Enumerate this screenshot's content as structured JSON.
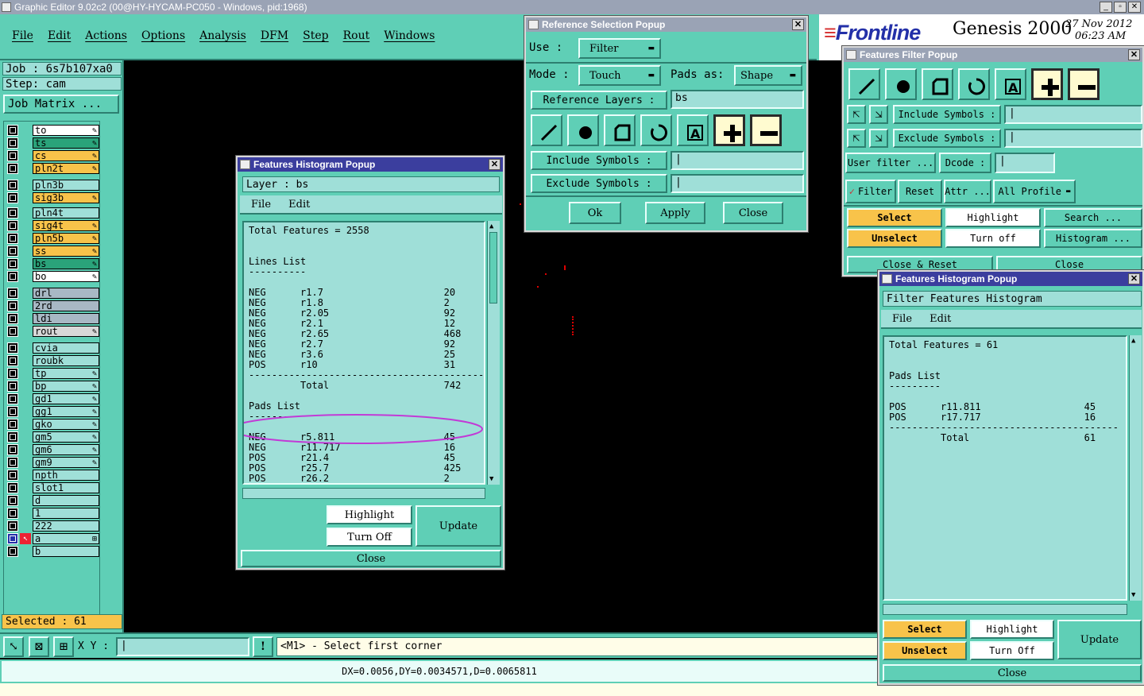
{
  "window_title": "Graphic Editor 9.02c2 (00@HY-HYCAM-PC050 - Windows, pid:1968)",
  "colors": {
    "teal": "#5fcfb6",
    "light": "#9fdfd8",
    "title_active": "#3b3e9e",
    "title_inactive": "#9aa3b5",
    "yellow": "#f8c34a",
    "highlight_ellipse": "#c23ad6"
  },
  "menu": [
    "File",
    "Edit",
    "Actions",
    "Options",
    "Analysis",
    "DFM",
    "Step",
    "Rout",
    "Windows"
  ],
  "brand": {
    "logo": "Frontline",
    "product": "Genesis 2000",
    "date": "27 Nov 2012",
    "time": "06:23 AM"
  },
  "job": {
    "job_label": "Job : 6s7b107xa0",
    "step_label": "Step: cam",
    "matrix_button": "Job Matrix ..."
  },
  "layers": [
    {
      "name": "to",
      "color": "#ffffff",
      "flag": true
    },
    {
      "name": "ts",
      "color": "#2aa37a",
      "flag": true
    },
    {
      "name": "cs",
      "color": "#f8c34a",
      "flag": true
    },
    {
      "name": "pln2t",
      "color": "#f8c34a",
      "flag": true
    },
    {
      "name": "pln3b",
      "color": "#9fdfd8",
      "flag": false
    },
    {
      "name": "sig3b",
      "color": "#f8c34a",
      "flag": true
    },
    {
      "name": "pln4t",
      "color": "#9fdfd8",
      "flag": false
    },
    {
      "name": "sig4t",
      "color": "#f8c34a",
      "flag": true
    },
    {
      "name": "pln5b",
      "color": "#f8c34a",
      "flag": true
    },
    {
      "name": "ss",
      "color": "#f8c34a",
      "flag": true
    },
    {
      "name": "bs",
      "color": "#2aa37a",
      "flag": true
    },
    {
      "name": "bo",
      "color": "#ffffff",
      "flag": true
    },
    {
      "name": "drl",
      "color": "#a8b8c4",
      "flag": false
    },
    {
      "name": "2rd",
      "color": "#a8b8c4",
      "flag": false
    },
    {
      "name": "ldi",
      "color": "#a8b8c4",
      "flag": false
    },
    {
      "name": "rout",
      "color": "#d8d8d8",
      "flag": true
    },
    {
      "name": "cvia",
      "color": "#9fdfd8",
      "flag": false
    },
    {
      "name": "roubk",
      "color": "#9fdfd8",
      "flag": false
    },
    {
      "name": "tp",
      "color": "#9fdfd8",
      "flag": true
    },
    {
      "name": "bp",
      "color": "#9fdfd8",
      "flag": true
    },
    {
      "name": "gd1",
      "color": "#9fdfd8",
      "flag": true
    },
    {
      "name": "gg1",
      "color": "#9fdfd8",
      "flag": true
    },
    {
      "name": "gko",
      "color": "#9fdfd8",
      "flag": true
    },
    {
      "name": "gm5",
      "color": "#9fdfd8",
      "flag": true
    },
    {
      "name": "gm6",
      "color": "#9fdfd8",
      "flag": true
    },
    {
      "name": "gm9",
      "color": "#9fdfd8",
      "flag": true
    },
    {
      "name": "npth",
      "color": "#9fdfd8",
      "flag": false
    },
    {
      "name": "slot1",
      "color": "#9fdfd8",
      "flag": false
    },
    {
      "name": "d",
      "color": "#9fdfd8",
      "flag": false
    },
    {
      "name": "1",
      "color": "#9fdfd8",
      "flag": false
    },
    {
      "name": "222",
      "color": "#9fdfd8",
      "flag": false
    },
    {
      "name": "a",
      "color": "#9fdfd8",
      "flag": true
    },
    {
      "name": "b",
      "color": "#9fdfd8",
      "flag": false
    }
  ],
  "selected_label": "Selected : 61",
  "bottom": {
    "xy_label": "X Y :",
    "prompt": "<M1> - Select first corner",
    "status": "DX=0.0056,DY=0.0034571,D=0.0065811"
  },
  "ref_popup": {
    "title": "Reference Selection Popup",
    "use_label": "Use  :",
    "use_value": "Filter",
    "mode_label": "Mode  :",
    "mode_value": "Touch",
    "pads_label": "Pads as:",
    "pads_value": "Shape",
    "ref_layers_label": "Reference Layers :",
    "ref_layers_value": "bs",
    "include_label": "Include Symbols :",
    "exclude_label": "Exclude Symbols :",
    "ok": "Ok",
    "apply": "Apply",
    "close": "Close"
  },
  "filter_popup": {
    "title": "Features Filter Popup",
    "include_label": "Include Symbols :",
    "exclude_label": "Exclude Symbols :",
    "user_filter": "User filter ...",
    "dcode": "Dcode :",
    "filter": "Filter",
    "reset": "Reset",
    "attr": "Attr ...",
    "profile": "All Profile",
    "select": "Select",
    "highlight": "Highlight",
    "search": "Search ...",
    "unselect": "Unselect",
    "turn_off": "Turn off",
    "histogram": "Histogram ...",
    "close_reset": "Close & Reset",
    "close": "Close"
  },
  "hist1": {
    "title": "Features Histogram Popup",
    "layer_label": "Layer :  bs",
    "menu_file": "File",
    "menu_edit": "Edit",
    "total": "Total Features = 2558",
    "lines_title": "Lines List",
    "lines": [
      [
        "NEG",
        "r1.7",
        "20"
      ],
      [
        "NEG",
        "r1.8",
        "2"
      ],
      [
        "NEG",
        "r2.05",
        "92"
      ],
      [
        "NEG",
        "r2.1",
        "12"
      ],
      [
        "NEG",
        "r2.65",
        "468"
      ],
      [
        "NEG",
        "r2.7",
        "92"
      ],
      [
        "NEG",
        "r3.6",
        "25"
      ],
      [
        "POS",
        "r10",
        "31"
      ]
    ],
    "lines_total_label": "Total",
    "lines_total": "742",
    "pads_title": "Pads List",
    "pads": [
      [
        "NEG",
        "r5.811",
        "45"
      ],
      [
        "NEG",
        "r11.717",
        "16"
      ],
      [
        "POS",
        "r21.4",
        "45"
      ],
      [
        "POS",
        "r25.7",
        "425"
      ],
      [
        "POS",
        "r26.2",
        "2"
      ]
    ],
    "highlight": "Highlight",
    "turn_off": "Turn Off",
    "update": "Update",
    "close": "Close"
  },
  "hist2": {
    "title": "Features Histogram Popup",
    "header": "Filter Features Histogram",
    "menu_file": "File",
    "menu_edit": "Edit",
    "total": "Total Features = 61",
    "pads_title": "Pads List",
    "pads": [
      [
        "POS",
        "r11.811",
        "45"
      ],
      [
        "POS",
        "r17.717",
        "16"
      ]
    ],
    "total_label": "Total",
    "total_value": "61",
    "select": "Select",
    "highlight": "Highlight",
    "update": "Update",
    "unselect": "Unselect",
    "turn_off": "Turn Off",
    "close": "Close"
  }
}
